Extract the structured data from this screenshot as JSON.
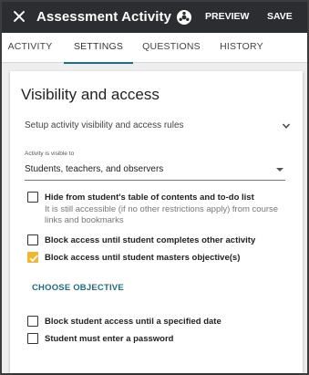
{
  "header": {
    "title": "Assessment Activity",
    "close_icon": "close-icon",
    "settings_icon": "gear-icon",
    "preview_label": "PREVIEW",
    "save_label": "SAVE"
  },
  "tabs": [
    {
      "label": "ACTIVITY",
      "active": false
    },
    {
      "label": "SETTINGS",
      "active": true
    },
    {
      "label": "QUESTIONS",
      "active": false
    },
    {
      "label": "HISTORY",
      "active": false
    }
  ],
  "card": {
    "title": "Visibility and access",
    "rules_label": "Setup activity visibility and access rules",
    "visibility": {
      "label": "Activity is visible to",
      "value": "Students, teachers, and observers"
    },
    "options": [
      {
        "label": "Hide from student's table of contents and to-do list",
        "note": "It is still accessible (if no other restrictions apply) from course links and bookmarks",
        "checked": false
      },
      {
        "label": "Block access until student completes other activity",
        "checked": false
      },
      {
        "label": "Block access until student masters objective(s)",
        "checked": true
      }
    ],
    "choose_objective_label": "CHOOSE OBJECTIVE",
    "more_options": [
      {
        "label": "Block student access until a specified date",
        "checked": false
      },
      {
        "label": "Student must enter a password",
        "checked": false
      }
    ]
  },
  "colors": {
    "topbar": "#2b2d30",
    "accent": "#1f6e83",
    "checkbox_checked": "#f2b632"
  }
}
